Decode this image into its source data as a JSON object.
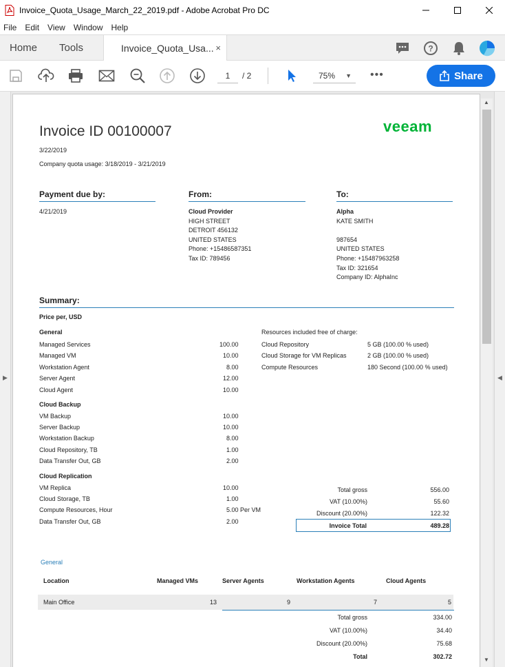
{
  "window": {
    "title": "Invoice_Quota_Usage_March_22_2019.pdf - Adobe Acrobat Pro DC"
  },
  "menu": [
    "File",
    "Edit",
    "View",
    "Window",
    "Help"
  ],
  "tabs": {
    "home": "Home",
    "tools": "Tools",
    "document": "Invoice_Quota_Usa...",
    "close": "×"
  },
  "toolbar": {
    "page_current": "1",
    "page_total": "/  2",
    "zoom": "75%",
    "more": "•••",
    "share": "Share"
  },
  "invoice": {
    "title": "Invoice ID 00100007",
    "logo": "VEEAM",
    "date": "3/22/2019",
    "quota_usage": "Company quota usage: 3/18/2019 - 3/21/2019",
    "payment_due_header": "Payment due by:",
    "payment_due_date": "4/21/2019",
    "from_header": "From:",
    "from_lines": [
      "Cloud Provider",
      "HIGH STREET",
      "DETROIT 456132",
      "UNITED STATES",
      "Phone: +15486587351",
      "Tax ID: 789456"
    ],
    "to_header": "To:",
    "to_lines": [
      "Alpha",
      "KATE SMITH",
      "",
      "987654",
      "UNITED STATES",
      "Phone: +15487963258",
      "Tax ID: 321654",
      "Company ID: AlphaInc"
    ],
    "summary_header": "Summary:",
    "price_per": "Price per, USD",
    "groups": [
      {
        "name": "General",
        "items": [
          {
            "label": "Managed Services",
            "value": "100.00"
          },
          {
            "label": "Managed VM",
            "value": "10.00"
          },
          {
            "label": "Workstation Agent",
            "value": "8.00"
          },
          {
            "label": "Server Agent",
            "value": "12.00"
          },
          {
            "label": "Cloud Agent",
            "value": "10.00"
          }
        ]
      },
      {
        "name": "Cloud Backup",
        "items": [
          {
            "label": "VM Backup",
            "value": "10.00"
          },
          {
            "label": "Server Backup",
            "value": "10.00"
          },
          {
            "label": "Workstation Backup",
            "value": "8.00"
          },
          {
            "label": "Cloud Repository, TB",
            "value": "1.00"
          },
          {
            "label": "Data Transfer Out, GB",
            "value": "2.00"
          }
        ]
      },
      {
        "name": "Cloud Replication",
        "items": [
          {
            "label": "VM Replica",
            "value": "10.00"
          },
          {
            "label": "Cloud Storage, TB",
            "value": "1.00"
          },
          {
            "label": "Compute Resources, Hour",
            "value": "5.00 Per VM"
          },
          {
            "label": "Data Transfer Out, GB",
            "value": "2.00"
          }
        ]
      }
    ],
    "free_header": "Resources included free of charge:",
    "free_items": [
      {
        "label": "Cloud Repository",
        "value": "5 GB (100.00 % used)"
      },
      {
        "label": "Cloud Storage for VM Replicas",
        "value": "2 GB (100.00 % used)"
      },
      {
        "label": "Compute Resources",
        "value": "180 Second (100.00 % used)"
      }
    ],
    "totals": [
      {
        "label": "Total gross",
        "value": "556.00"
      },
      {
        "label": "VAT (10.00%)",
        "value": "55.60"
      },
      {
        "label": "Discount (20.00%)",
        "value": "122.32"
      }
    ],
    "invoice_total_label": "Invoice Total",
    "invoice_total_value": "489.28",
    "general_section": "General",
    "table_headers": [
      "Location",
      "Managed VMs",
      "Server Agents",
      "Workstation Agents",
      "Cloud  Agents"
    ],
    "table_row": [
      "Main Office",
      "13",
      "9",
      "7",
      "5"
    ],
    "table_totals": [
      {
        "label": "Total gross",
        "value": "334.00"
      },
      {
        "label": "VAT (10.00%)",
        "value": "34.40"
      },
      {
        "label": "Discount (20.00%)",
        "value": "75.68"
      },
      {
        "label": "Total",
        "value": "302.72"
      }
    ]
  },
  "colors": {
    "accent": "#2a7fb8",
    "share": "#1473e6",
    "veeam_green": "#00b336"
  }
}
